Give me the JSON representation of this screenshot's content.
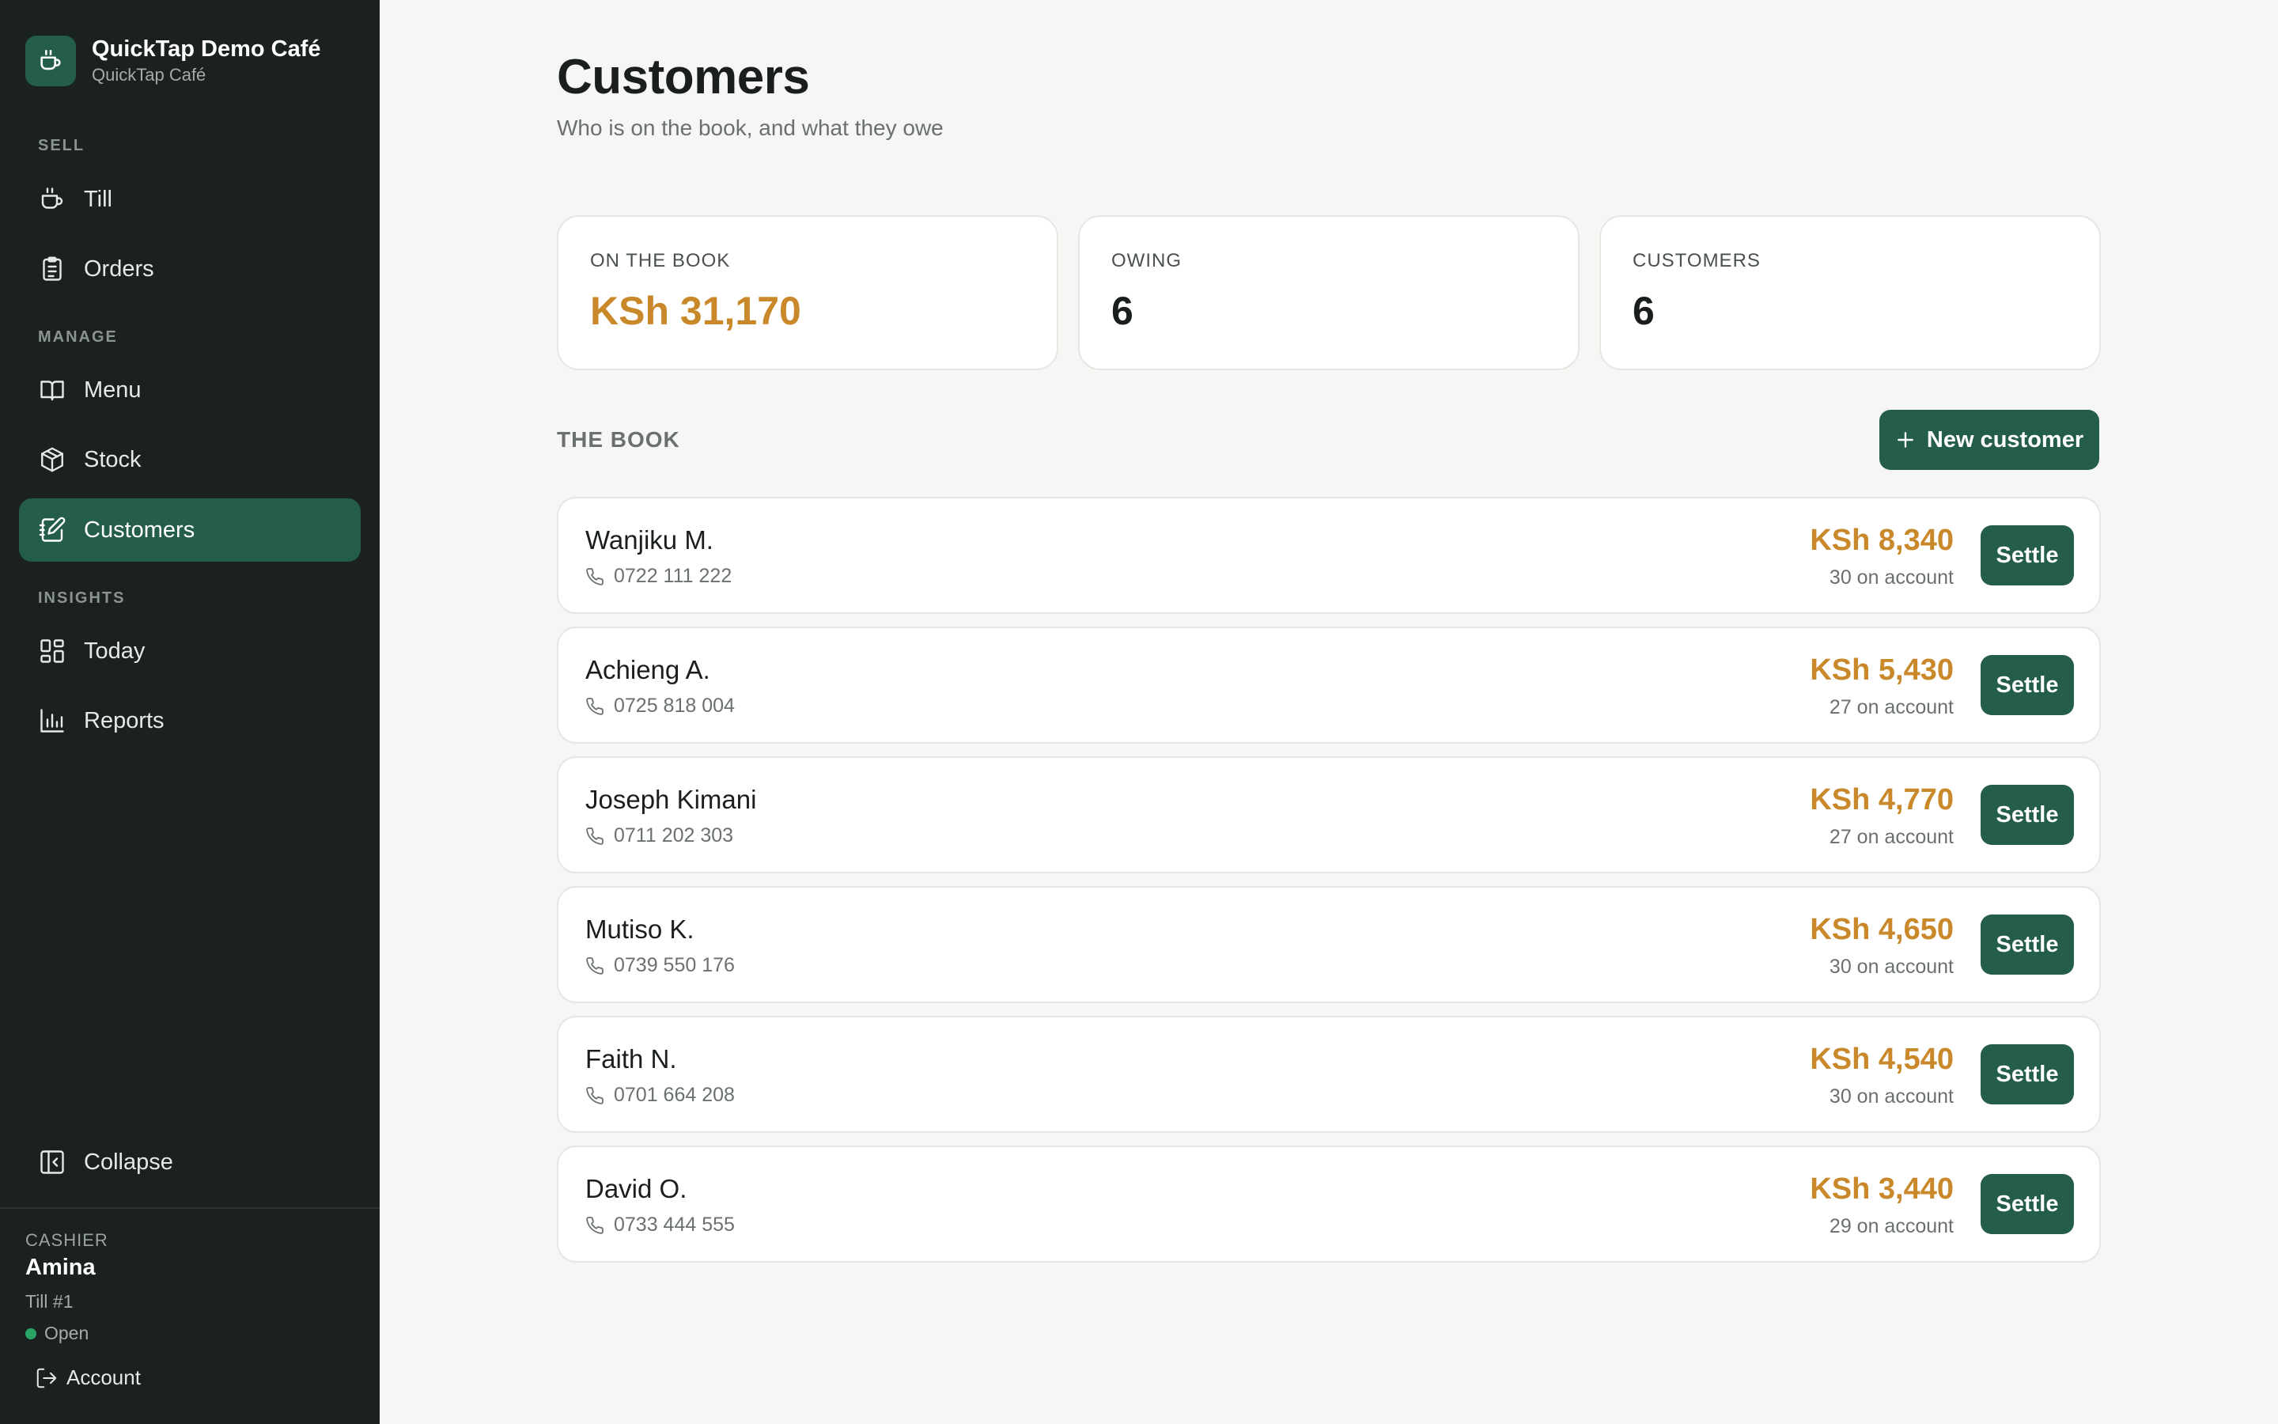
{
  "brand": {
    "name": "QuickTap Demo Café",
    "subtitle": "QuickTap Café"
  },
  "sidebar": {
    "sections": {
      "sell": "SELL",
      "manage": "MANAGE",
      "insights": "INSIGHTS"
    },
    "items": [
      {
        "label": "Till",
        "icon": "cup-icon"
      },
      {
        "label": "Orders",
        "icon": "clipboard-icon"
      },
      {
        "label": "Menu",
        "icon": "book-open-icon"
      },
      {
        "label": "Stock",
        "icon": "box-icon"
      },
      {
        "label": "Customers",
        "icon": "ledger-icon",
        "active": true
      },
      {
        "label": "Today",
        "icon": "dashboard-icon"
      },
      {
        "label": "Reports",
        "icon": "bar-chart-icon"
      }
    ],
    "collapse_label": "Collapse",
    "cashier": {
      "label": "CASHIER",
      "name": "Amina",
      "till": "Till #1",
      "status": "Open",
      "account_label": "Account"
    }
  },
  "main": {
    "title": "Customers",
    "subtitle": "Who is on the book, and what they owe",
    "stats": [
      {
        "label": "ON THE BOOK",
        "value": "KSh 31,170"
      },
      {
        "label": "OWING",
        "value": "6"
      },
      {
        "label": "CUSTOMERS",
        "value": "6"
      }
    ],
    "book_heading": "THE BOOK",
    "new_customer_label": "New customer",
    "settle_label": "Settle",
    "customers": [
      {
        "name": "Wanjiku M.",
        "phone": "0722 111 222",
        "amount": "KSh 8,340",
        "account": "30 on account"
      },
      {
        "name": "Achieng A.",
        "phone": "0725 818 004",
        "amount": "KSh 5,430",
        "account": "27 on account"
      },
      {
        "name": "Joseph Kimani",
        "phone": "0711 202 303",
        "amount": "KSh 4,770",
        "account": "27 on account"
      },
      {
        "name": "Mutiso K.",
        "phone": "0739 550 176",
        "amount": "KSh 4,650",
        "account": "30 on account"
      },
      {
        "name": "Faith N.",
        "phone": "0701 664 208",
        "amount": "KSh 4,540",
        "account": "30 on account"
      },
      {
        "name": "David O.",
        "phone": "0733 444 555",
        "amount": "KSh 3,440",
        "account": "29 on account"
      }
    ]
  },
  "colors": {
    "sidebar_bg": "#1a211e",
    "accent_green": "#255e48",
    "amount_amber": "#c9892a",
    "status_green": "#2aa566",
    "page_bg": "#f6f6f4"
  }
}
